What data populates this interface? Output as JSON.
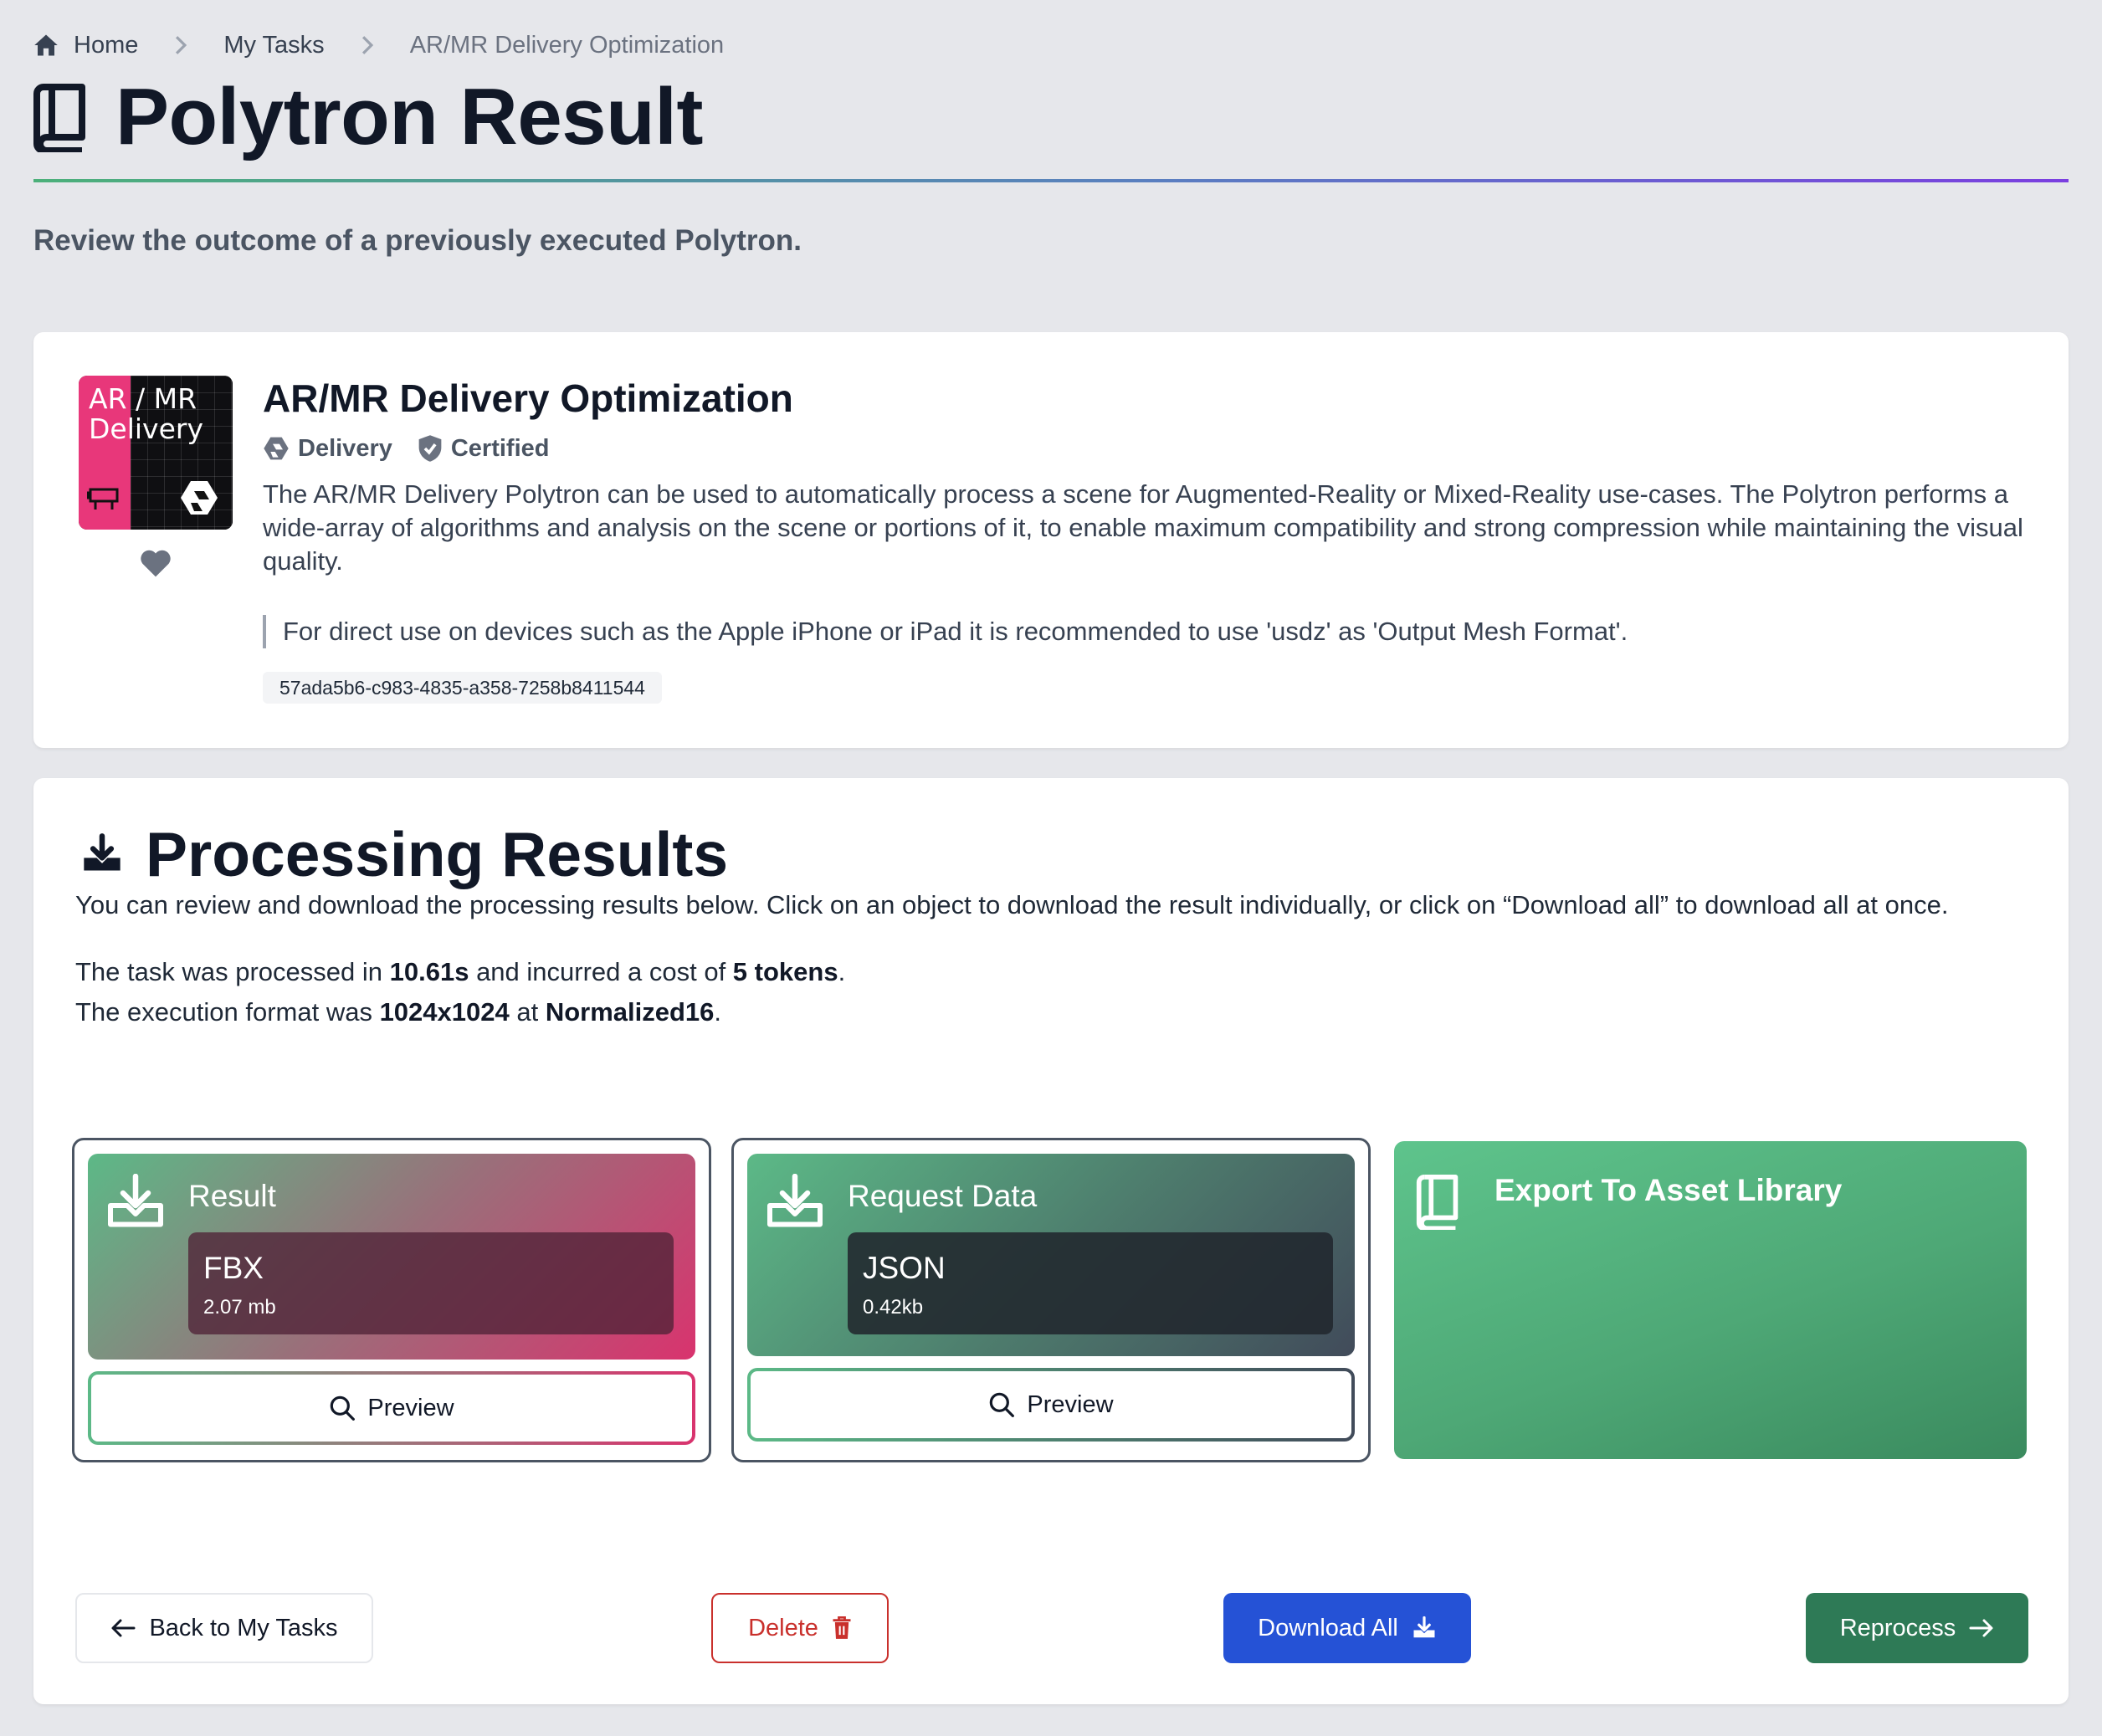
{
  "breadcrumb": {
    "home": "Home",
    "tasks": "My Tasks",
    "current": "AR/MR Delivery Optimization"
  },
  "page": {
    "title": "Polytron Result",
    "subtitle": "Review the outcome of a previously executed Polytron."
  },
  "polytron": {
    "thumb_line1": "AR / MR",
    "thumb_line2": "Delivery",
    "name": "AR/MR Delivery Optimization",
    "tag_category": "Delivery",
    "tag_certified": "Certified",
    "description": "The AR/MR Delivery Polytron can be used to automatically process a scene for Augmented-Reality or Mixed-Reality use-cases. The Polytron performs a wide-array of algorithms and analysis on the scene or portions of it, to enable maximum compatibility and strong compression while maintaining the visual quality.",
    "note": "For direct use on devices such as the Apple iPhone or iPad it is recommended to use 'usdz' as 'Output Mesh Format'.",
    "id": "57ada5b6-c983-4835-a358-7258b8411544"
  },
  "results": {
    "title": "Processing Results",
    "intro": "You can review and download the processing results below. Click on an object to download the result individually, or click on “Download all” to download all at once.",
    "line1_a": "The task was processed in ",
    "time": "10.61s",
    "line1_b": " and incurred a cost of ",
    "cost": "5 tokens",
    "line1_c": ".",
    "line2_a": "The execution format was ",
    "resolution": "1024x1024",
    "line2_b": " at ",
    "precision": "Normalized16",
    "line2_c": ".",
    "items": [
      {
        "label": "Result",
        "format": "FBX",
        "size": "2.07 mb",
        "preview": "Preview"
      },
      {
        "label": "Request Data",
        "format": "JSON",
        "size": "0.42kb",
        "preview": "Preview"
      }
    ],
    "export_label": "Export To Asset Library"
  },
  "actions": {
    "back": "Back to My Tasks",
    "delete": "Delete",
    "download_all": "Download All",
    "reprocess": "Reprocess"
  },
  "colors": {
    "accent_blue": "#2552d6",
    "accent_green": "#2e7a56",
    "danger": "#c9302c",
    "brand_pink": "#e8377a"
  }
}
